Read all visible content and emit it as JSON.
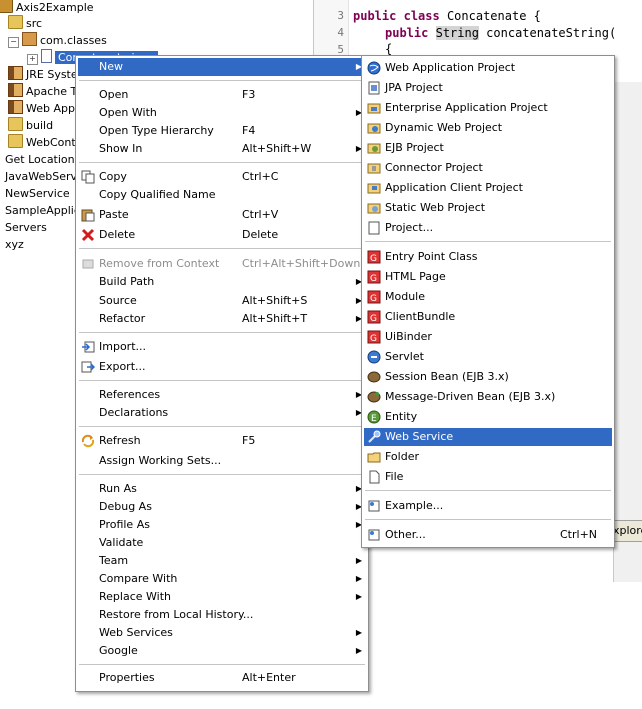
{
  "explorer": {
    "items": [
      {
        "label": "Axis2Example",
        "icon": "project-icon"
      },
      {
        "label": "src",
        "icon": "source-folder-icon"
      },
      {
        "label": "com.classes",
        "icon": "package-icon"
      },
      {
        "label": "Concatenate.java",
        "icon": "java-file-icon"
      },
      {
        "label": "JRE System Library",
        "icon": "library-icon"
      },
      {
        "label": "Apache Tomcat",
        "icon": "library-icon"
      },
      {
        "label": "Web App Libraries",
        "icon": "library-icon"
      },
      {
        "label": "build",
        "icon": "folder-icon"
      },
      {
        "label": "WebContent",
        "icon": "folder-icon"
      },
      {
        "label": "Get Location Demo",
        "icon": "project-icon"
      },
      {
        "label": "JavaWebService",
        "icon": "project-icon"
      },
      {
        "label": "NewService",
        "icon": "project-icon"
      },
      {
        "label": "SampleApplication",
        "icon": "project-icon"
      },
      {
        "label": "Servers",
        "icon": "project-icon"
      },
      {
        "label": "xyz",
        "icon": "project-icon"
      }
    ]
  },
  "editor": {
    "line_numbers": [
      "3",
      "4",
      "5"
    ],
    "line3_kw1": "public",
    "line3_kw2": "class",
    "line3_rest": " Concatenate {",
    "line4_kw1": "public",
    "line4_type": "String",
    "line4_rest": " concatenateString(",
    "line5": "{"
  },
  "context_menu": {
    "items": [
      {
        "label": "New",
        "shortcut": "",
        "submenu": true,
        "selected": true
      },
      {
        "label": "Open",
        "shortcut": "F3"
      },
      {
        "label": "Open With",
        "submenu": true
      },
      {
        "label": "Open Type Hierarchy",
        "shortcut": "F4"
      },
      {
        "label": "Show In",
        "shortcut": "Alt+Shift+W",
        "submenu": true
      },
      {
        "label": "Copy",
        "shortcut": "Ctrl+C",
        "icon": "copy-icon"
      },
      {
        "label": "Copy Qualified Name",
        "icon": "copy-qualified-icon"
      },
      {
        "label": "Paste",
        "shortcut": "Ctrl+V",
        "icon": "paste-icon"
      },
      {
        "label": "Delete",
        "shortcut": "Delete",
        "icon": "delete-icon"
      },
      {
        "label": "Remove from Context",
        "shortcut": "Ctrl+Alt+Shift+Down",
        "disabled": true,
        "icon": "remove-context-icon"
      },
      {
        "label": "Build Path",
        "submenu": true
      },
      {
        "label": "Source",
        "shortcut": "Alt+Shift+S",
        "submenu": true
      },
      {
        "label": "Refactor",
        "shortcut": "Alt+Shift+T",
        "submenu": true
      },
      {
        "label": "Import...",
        "icon": "import-icon"
      },
      {
        "label": "Export...",
        "icon": "export-icon"
      },
      {
        "label": "References",
        "submenu": true
      },
      {
        "label": "Declarations",
        "submenu": true
      },
      {
        "label": "Refresh",
        "shortcut": "F5",
        "icon": "refresh-icon"
      },
      {
        "label": "Assign Working Sets..."
      },
      {
        "label": "Run As",
        "submenu": true
      },
      {
        "label": "Debug As",
        "submenu": true
      },
      {
        "label": "Profile As",
        "submenu": true
      },
      {
        "label": "Validate"
      },
      {
        "label": "Team",
        "submenu": true
      },
      {
        "label": "Compare With",
        "submenu": true
      },
      {
        "label": "Replace With",
        "submenu": true
      },
      {
        "label": "Restore from Local History..."
      },
      {
        "label": "Web Services",
        "submenu": true
      },
      {
        "label": "Google",
        "submenu": true
      },
      {
        "label": "Properties",
        "shortcut": "Alt+Enter"
      }
    ]
  },
  "submenu": {
    "items": [
      {
        "label": "Web Application Project",
        "icon": "web-app-project-icon"
      },
      {
        "label": "JPA Project",
        "icon": "jpa-project-icon"
      },
      {
        "label": "Enterprise Application Project",
        "icon": "enterprise-project-icon"
      },
      {
        "label": "Dynamic Web Project",
        "icon": "dynamic-web-project-icon"
      },
      {
        "label": "EJB Project",
        "icon": "ejb-project-icon"
      },
      {
        "label": "Connector Project",
        "icon": "connector-project-icon"
      },
      {
        "label": "Application Client Project",
        "icon": "app-client-project-icon"
      },
      {
        "label": "Static Web Project",
        "icon": "static-web-project-icon"
      },
      {
        "label": "Project...",
        "icon": "project-wizard-icon"
      },
      {
        "label": "Entry Point Class",
        "icon": "gwt-entry-point-icon"
      },
      {
        "label": "HTML Page",
        "icon": "gwt-html-page-icon"
      },
      {
        "label": "Module",
        "icon": "gwt-module-icon"
      },
      {
        "label": "ClientBundle",
        "icon": "gwt-clientbundle-icon"
      },
      {
        "label": "UiBinder",
        "icon": "gwt-uibinder-icon"
      },
      {
        "label": "Servlet",
        "icon": "servlet-icon"
      },
      {
        "label": "Session Bean (EJB 3.x)",
        "icon": "session-bean-icon"
      },
      {
        "label": "Message-Driven Bean (EJB 3.x)",
        "icon": "message-bean-icon"
      },
      {
        "label": "Entity",
        "icon": "entity-icon"
      },
      {
        "label": "Web Service",
        "icon": "web-service-icon",
        "selected": true
      },
      {
        "label": "Folder",
        "icon": "folder-icon"
      },
      {
        "label": "File",
        "icon": "file-icon"
      },
      {
        "label": "Example...",
        "icon": "example-icon"
      },
      {
        "label": "Other...",
        "shortcut": "Ctrl+N",
        "icon": "other-wizard-icon"
      }
    ]
  },
  "right_tab": {
    "label": "xplore"
  },
  "colors": {
    "selection": "#316ac5",
    "keyword": "#7f0055"
  }
}
